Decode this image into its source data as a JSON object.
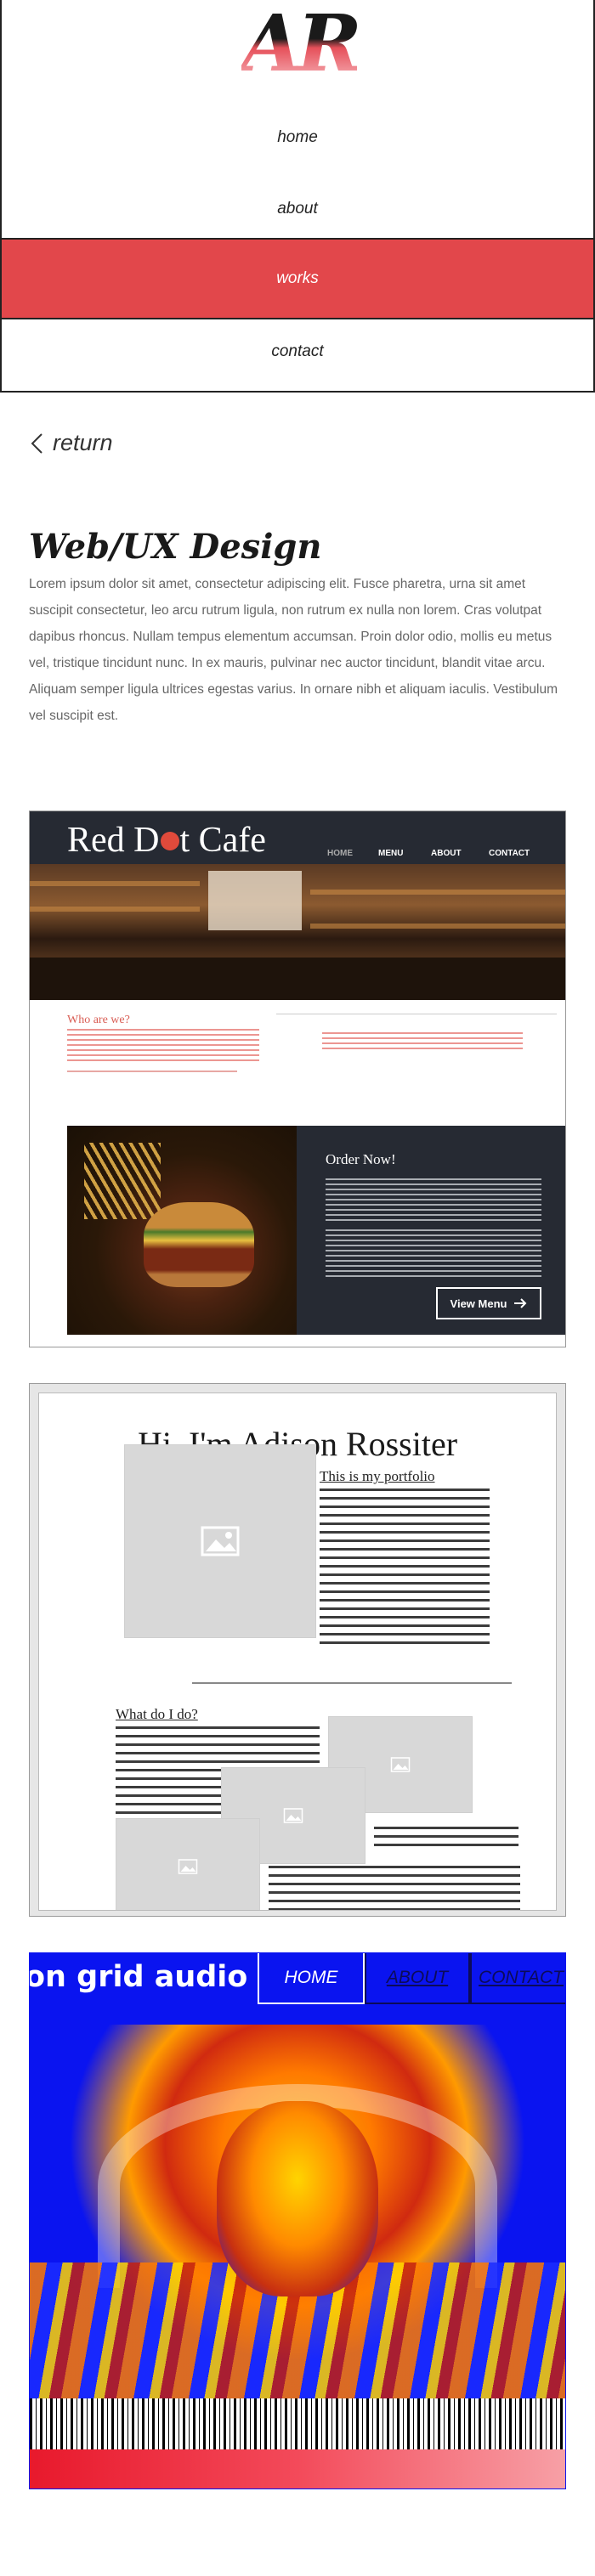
{
  "logo": "AR",
  "nav": {
    "items": [
      {
        "label": "home"
      },
      {
        "label": "about"
      },
      {
        "label": "works"
      },
      {
        "label": "contact"
      }
    ],
    "active": "works",
    "active_color": "#e2474b"
  },
  "return_link": {
    "label": "return",
    "icon": "chevron-left-icon"
  },
  "page": {
    "title": "Web/UX Design",
    "intro": "Lorem ipsum dolor sit amet, consectetur adipiscing elit. Fusce pharetra, urna sit amet suscipit consectetur, leo arcu rutrum ligula, non rutrum ex nulla non lorem. Cras volutpat dapibus rhoncus. Nullam tempus elementum accumsan. Proin dolor odio, mollis eu metus vel, tristique tincidunt nunc. In ex mauris, pulvinar nec auctor tincidunt, blandit vitae arcu. Aliquam semper ligula ultrices egestas varius. In ornare nibh et aliquam iaculis. Vestibulum vel suscipit est."
  },
  "projects": {
    "red_dot_cafe": {
      "logo_pre": "Red D",
      "logo_post": "t Cafe",
      "nav": [
        "HOME",
        "MENU",
        "ABOUT",
        "CONTACT"
      ],
      "who_heading": "Who are we?",
      "order_heading": "Order Now!",
      "button_label": "View Menu",
      "accent": "#e04a3b",
      "dark": "#262a33"
    },
    "portfolio": {
      "title": "Hi, I'm Adison Rossiter",
      "subtitle": "This is my portfolio",
      "section_heading": "What do I do?"
    },
    "on_grid_audio": {
      "logo": "on grid audio",
      "tabs": [
        "HOME",
        "ABOUT",
        "CONTACT"
      ],
      "bg_color": "#0a14f0"
    }
  }
}
